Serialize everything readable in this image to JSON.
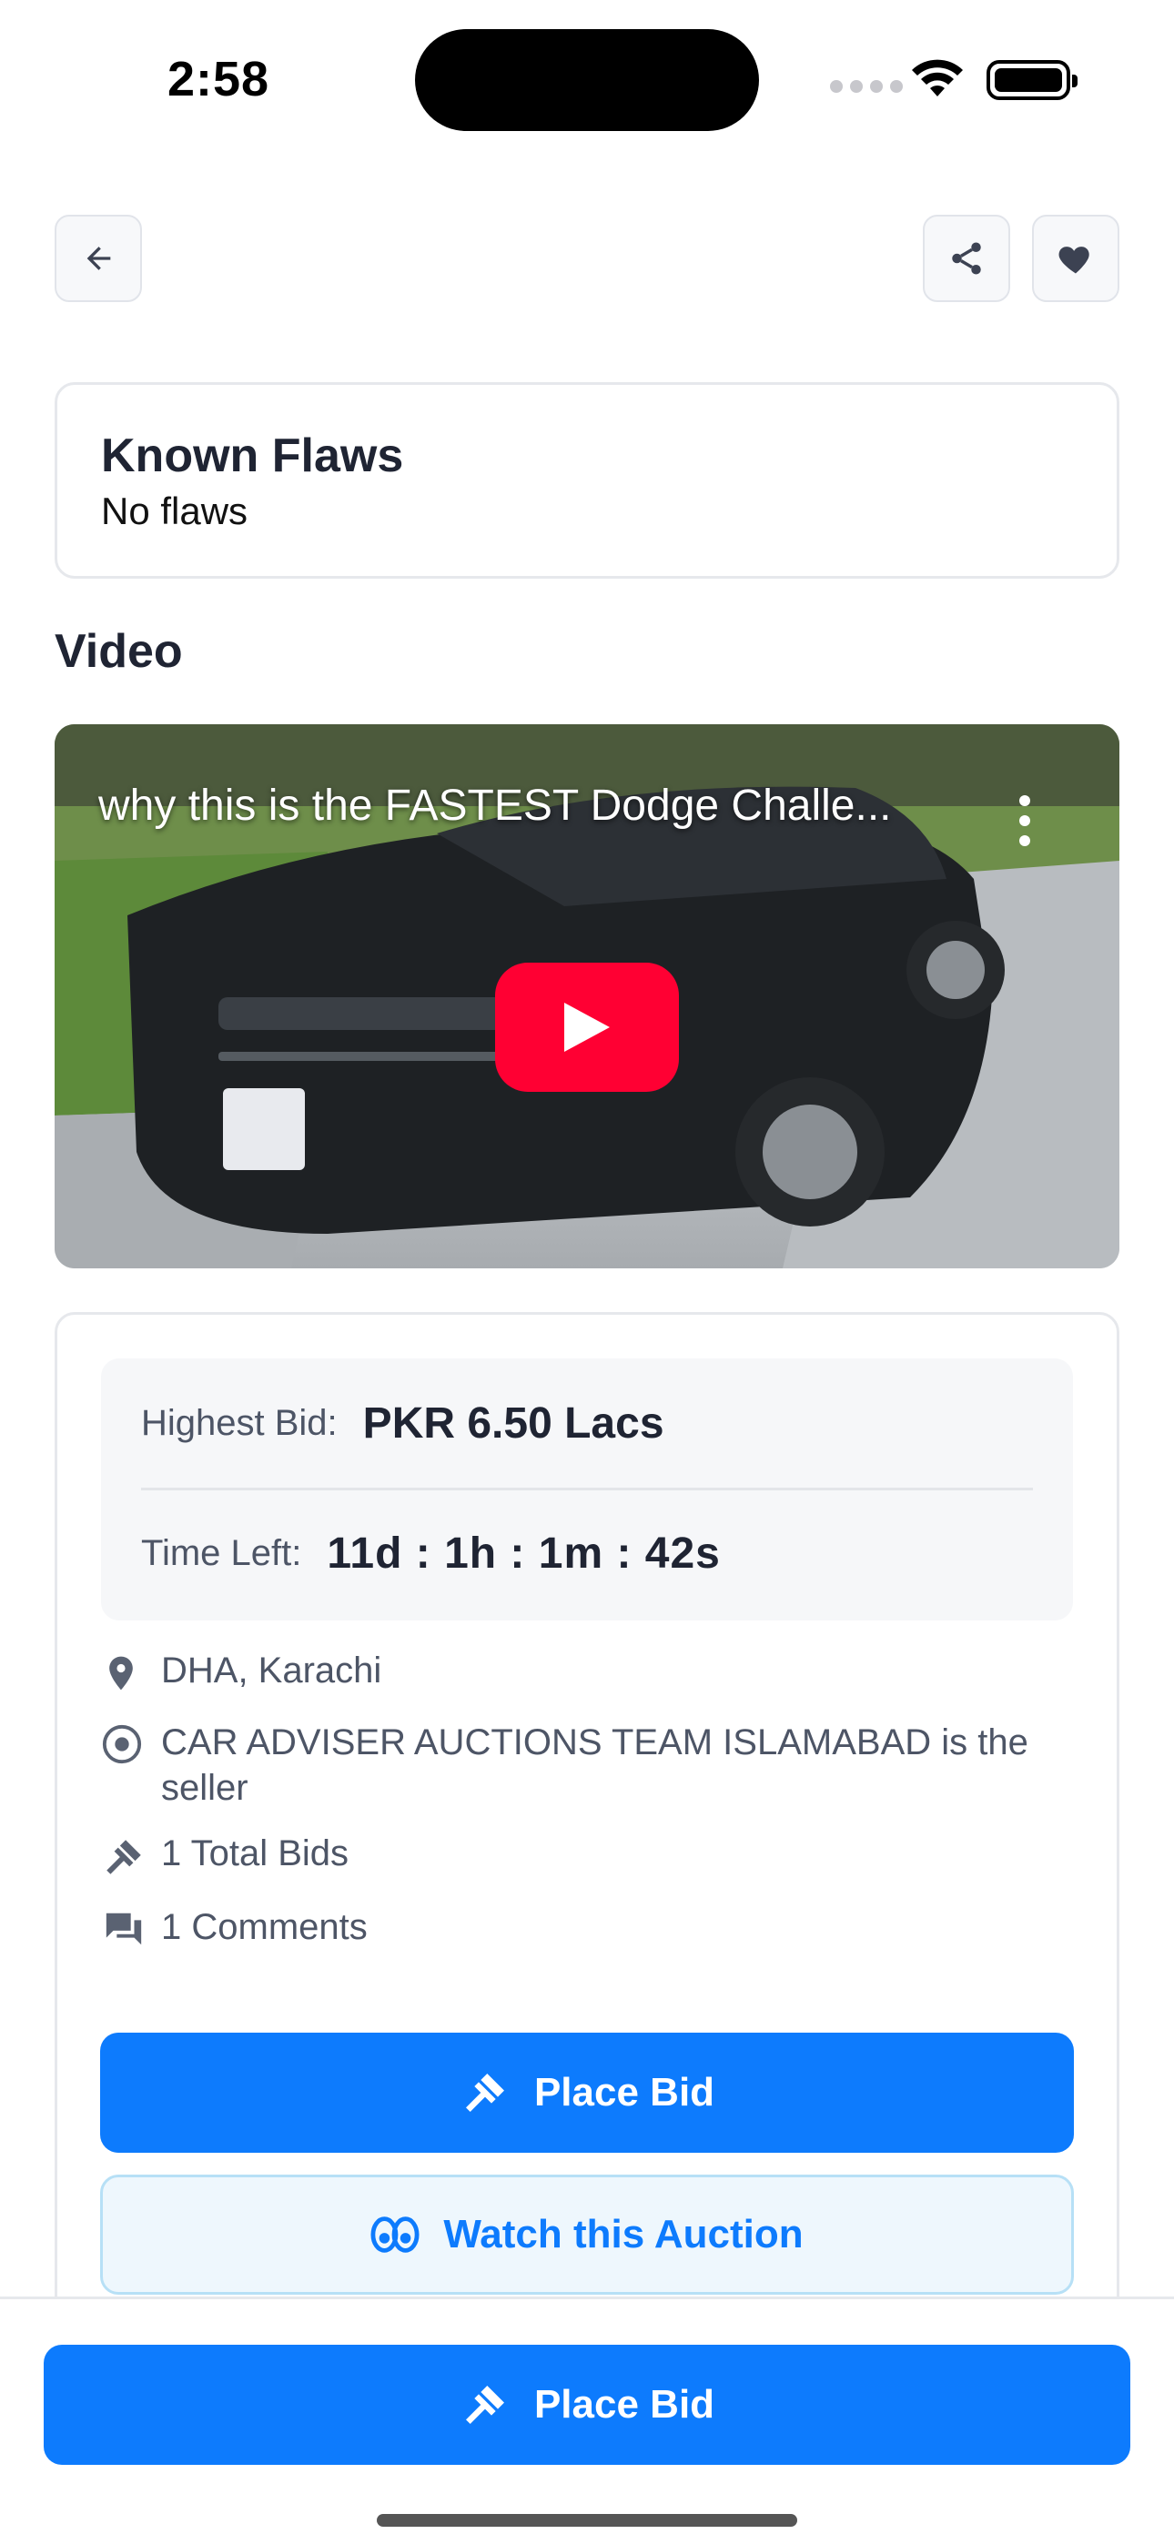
{
  "status_bar": {
    "time": "2:58"
  },
  "nav": {
    "back_icon": "arrow-left-icon",
    "share_icon": "share-icon",
    "favorite_icon": "heart-icon"
  },
  "known_flaws": {
    "title": "Known Flaws",
    "value": "No flaws"
  },
  "video_section": {
    "title": "Video",
    "video_title": "why this is the FASTEST Dodge Challe..."
  },
  "auction": {
    "highest_bid_label": "Highest Bid:",
    "highest_bid_value": "PKR 6.50 Lacs",
    "time_left_label": "Time Left:",
    "time_left_value": "11d : 1h : 1m : 42s",
    "location": "DHA, Karachi",
    "seller": "CAR ADVISER AUCTIONS TEAM ISLAMABAD is the seller",
    "total_bids": "1 Total Bids",
    "comments": "1 Comments",
    "place_bid_label": "Place Bid",
    "watch_label": "Watch this Auction"
  },
  "bottom_bar": {
    "place_bid_label": "Place Bid"
  },
  "colors": {
    "primary": "#0d7bfd",
    "watch_bg": "#eef7fd",
    "youtube_red": "#ff0033",
    "text_dark": "#1f2433",
    "text_muted": "#4d5566"
  }
}
